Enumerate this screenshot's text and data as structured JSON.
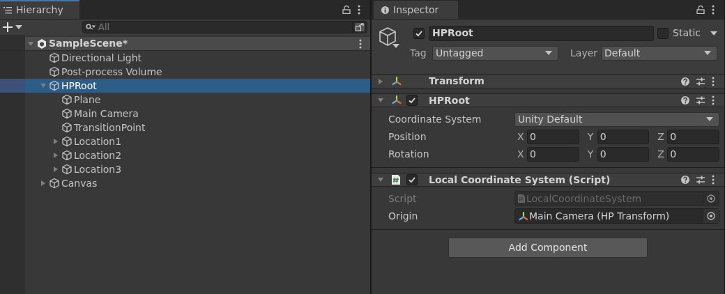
{
  "hierarchy": {
    "tab": "Hierarchy",
    "search": {
      "placeholder": "All"
    },
    "scene": {
      "name": "SampleScene*",
      "expanded": true,
      "selected": false,
      "children": [
        {
          "name": "Directional Light",
          "selected": false
        },
        {
          "name": "Post-process Volume",
          "selected": false
        },
        {
          "name": "HPRoot",
          "selected": true,
          "expanded": true,
          "children": [
            {
              "name": "Plane",
              "selected": false
            },
            {
              "name": "Main Camera",
              "selected": false
            },
            {
              "name": "TransitionPoint",
              "selected": false
            },
            {
              "name": "Location1",
              "selected": false,
              "expanded": false
            },
            {
              "name": "Location2",
              "selected": false,
              "expanded": false
            },
            {
              "name": "Location3",
              "selected": false,
              "expanded": false
            }
          ]
        },
        {
          "name": "Canvas",
          "selected": false,
          "expanded": false
        }
      ]
    }
  },
  "inspector": {
    "tab": "Inspector",
    "object": {
      "active": true,
      "name": "HPRoot",
      "static": false,
      "static_label": "Static",
      "tag_label": "Tag",
      "tag": "Untagged",
      "layer_label": "Layer",
      "layer": "Default"
    },
    "components": [
      {
        "kind": "transform",
        "name": "Transform",
        "expanded": false
      },
      {
        "kind": "transform",
        "name": "HPRoot",
        "expanded": true,
        "enabled": true,
        "fields": [
          {
            "kind": "dropdown",
            "label": "Coordinate System",
            "value": "Unity Default"
          },
          {
            "kind": "vector",
            "label": "Position",
            "axes": [
              {
                "axis": "X",
                "value": "0"
              },
              {
                "axis": "Y",
                "value": "0"
              },
              {
                "axis": "Z",
                "value": "0"
              }
            ]
          },
          {
            "kind": "vector",
            "label": "Rotation",
            "axes": [
              {
                "axis": "X",
                "value": "0"
              },
              {
                "axis": "Y",
                "value": "0"
              },
              {
                "axis": "Z",
                "value": "0"
              }
            ]
          }
        ]
      },
      {
        "kind": "script",
        "name": "Local Coordinate System (Script)",
        "expanded": true,
        "enabled": true,
        "fields": [
          {
            "kind": "script_ref",
            "label": "Script",
            "value": "LocalCoordinateSystem",
            "disabled": true
          },
          {
            "kind": "object",
            "label": "Origin",
            "value": "Main Camera (HP Transform)",
            "disabled": false
          }
        ]
      }
    ],
    "add_button": "Add Component"
  }
}
